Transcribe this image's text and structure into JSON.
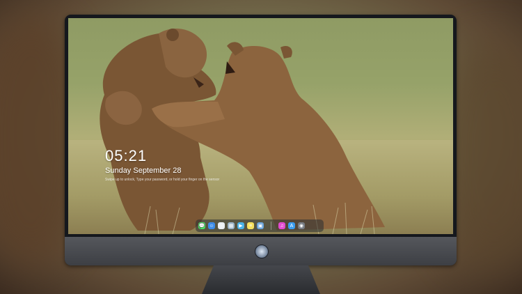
{
  "lock_screen": {
    "time": "05:21",
    "date": "Sunday September 28",
    "hint": "Swipe up to unlock, Type your password, or hold your finger on the sensor"
  },
  "dock": {
    "icons": [
      {
        "name": "messages-icon",
        "glyph": "💬",
        "color": "#4cd964"
      },
      {
        "name": "finder-icon",
        "glyph": "☺",
        "color": "#3b8be8"
      },
      {
        "name": "safari-icon",
        "glyph": "◎",
        "color": "#e9eef3"
      },
      {
        "name": "preview-icon",
        "glyph": "▦",
        "color": "#9bb4c8"
      },
      {
        "name": "videos-icon",
        "glyph": "▶",
        "color": "#4ab3e8"
      },
      {
        "name": "notes-icon",
        "glyph": "≡",
        "color": "#f6e05e"
      },
      {
        "name": "photos-icon",
        "glyph": "▣",
        "color": "#6aa3d8"
      },
      {
        "name": "itunes-icon",
        "glyph": "♫",
        "color": "#e24bd1"
      },
      {
        "name": "app-store-icon",
        "glyph": "A",
        "color": "#3a9cf0"
      },
      {
        "name": "camera-icon",
        "glyph": "◉",
        "color": "#777b82"
      }
    ]
  }
}
